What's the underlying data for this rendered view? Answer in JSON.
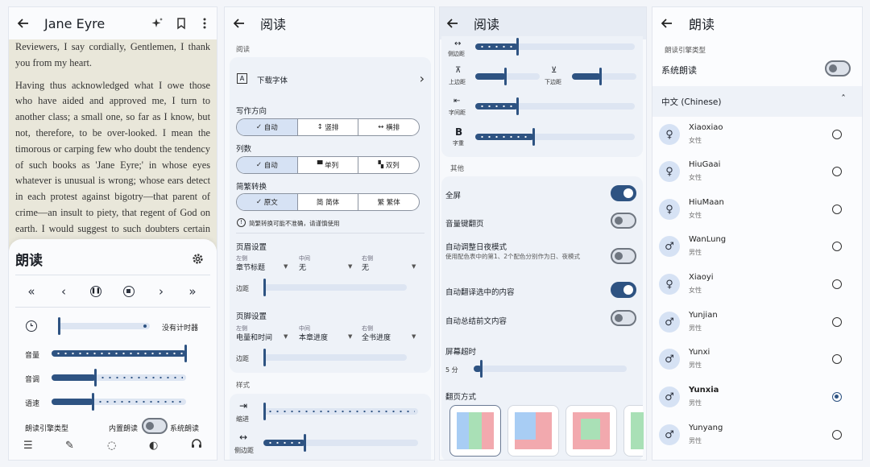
{
  "reader": {
    "title": "Jane Eyre",
    "paragraphs": [
      "Reviewers, I say cordially, Gentlemen, I thank you from my heart.",
      "Having thus acknowledged what I owe those who have aided and approved me, I turn to another class; a small one, so far as I know, but not, therefore, to be over-looked. I mean the timorous or carping few who doubt the tendency of such books as 'Jane Eyre;' in whose eyes whatever is unusual is wrong; whose ears detect in each protest against bigotry—that parent of crime—an insult to piety, that regent of God on earth. I would suggest to such doubters certain obvious distinctions; I would re-mind them of certain simple truths."
    ],
    "tts": {
      "title": "朗读",
      "timer_label": "没有计时器",
      "volume_label": "音量",
      "pitch_label": "音调",
      "speed_label": "语速",
      "engine_type_label": "朗读引擎类型",
      "builtin_label": "内置朗读",
      "system_label": "系统朗读",
      "volume_level": 1.0,
      "pitch_level": 0.33,
      "speed_level": 0.31
    }
  },
  "settings_a": {
    "title": "阅读",
    "section_reading": "阅读",
    "download_font": "下载字体",
    "writing_direction": {
      "label": "写作方向",
      "options": [
        "自动",
        "竖排",
        "横排"
      ],
      "selected": "自动"
    },
    "columns": {
      "label": "列数",
      "options": [
        "自动",
        "单列",
        "双列"
      ],
      "selected": "自动"
    },
    "conversion": {
      "label": "简繁转换",
      "options": [
        "原文",
        "简体",
        "繁体"
      ],
      "selected": "原文",
      "warning": "简繁转换可能不准确，请谨慎使用"
    },
    "header": {
      "label": "页眉设置",
      "left_caption": "左侧",
      "left_value": "章节标题",
      "mid_caption": "中间",
      "mid_value": "无",
      "right_caption": "右侧",
      "right_value": "无",
      "margin_label": "边距"
    },
    "footer": {
      "label": "页脚设置",
      "left_caption": "左侧",
      "left_value": "电量和时间",
      "mid_caption": "中间",
      "mid_value": "本章进度",
      "right_caption": "右侧",
      "right_value": "全书进度",
      "margin_label": "边距"
    },
    "section_style": "样式",
    "indent_label": "缩进",
    "side_margin_label": "侧边距",
    "side_margin_level": 0.27
  },
  "settings_b": {
    "title": "阅读",
    "side_margin_label": "侧边距",
    "top_margin_label": "上边距",
    "bottom_margin_label": "下边距",
    "letter_spacing_label": "字间距",
    "font_weight_label": "字重",
    "side_margin_level": 0.27,
    "top_margin_level": 0.48,
    "bottom_margin_level": 0.45,
    "letter_spacing_level": 0.27,
    "font_weight_level": 0.37,
    "section_other": "其他",
    "toggles": [
      {
        "label": "全屏",
        "on": true
      },
      {
        "label": "音量键翻页",
        "on": false
      },
      {
        "label": "自动调整日夜模式",
        "sub": "使用配色表中的第1、2个配色分别作为日、夜模式",
        "on": false
      },
      {
        "label": "自动翻译选中的内容",
        "on": true
      },
      {
        "label": "自动总结前文内容",
        "on": false
      }
    ],
    "screen_timeout_label": "屏幕超时",
    "screen_timeout_value": "5 分",
    "page_turn_label": "翻页方式"
  },
  "tts_engine": {
    "title": "朗读",
    "section": "朗读引擎类型",
    "system_tts_label": "系统朗读",
    "language": "中文 (Chinese)",
    "voices": [
      {
        "name": "Xiaoxiao",
        "gender": "女性",
        "icon": "female-icon",
        "selected": false
      },
      {
        "name": "HiuGaai",
        "gender": "女性",
        "icon": "female-icon",
        "selected": false
      },
      {
        "name": "HiuMaan",
        "gender": "女性",
        "icon": "female-icon",
        "selected": false
      },
      {
        "name": "WanLung",
        "gender": "男性",
        "icon": "male-icon",
        "selected": false
      },
      {
        "name": "Xiaoyi",
        "gender": "女性",
        "icon": "female-icon",
        "selected": false
      },
      {
        "name": "Yunjian",
        "gender": "男性",
        "icon": "male-icon",
        "selected": false
      },
      {
        "name": "Yunxi",
        "gender": "男性",
        "icon": "male-icon",
        "selected": false
      },
      {
        "name": "Yunxia",
        "gender": "男性",
        "icon": "male-icon",
        "selected": true
      },
      {
        "name": "Yunyang",
        "gender": "男性",
        "icon": "male-icon",
        "selected": false
      }
    ]
  },
  "colors": {
    "accent": "#2e5382",
    "track": "#dde5f2",
    "card": "#eef2f8",
    "selected_segment": "#d6e2f4",
    "paper": "#e9e7da"
  }
}
